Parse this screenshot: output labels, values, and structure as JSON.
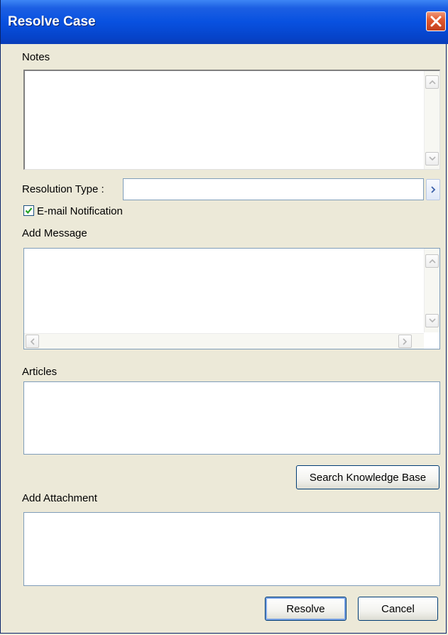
{
  "window": {
    "title": "Resolve Case"
  },
  "notes": {
    "label": "Notes",
    "value": ""
  },
  "resolution_type": {
    "label": "Resolution Type :",
    "value": ""
  },
  "email_notification": {
    "label": "E-mail Notification",
    "checked": true
  },
  "add_message": {
    "label": "Add Message",
    "value": ""
  },
  "articles": {
    "label": "Articles"
  },
  "search_kb": {
    "label": "Search Knowledge Base"
  },
  "add_attachment": {
    "label": "Add Attachment"
  },
  "footer": {
    "resolve_label": "Resolve",
    "cancel_label": "Cancel"
  },
  "icons": {
    "close": "close-icon",
    "scroll_up": "chevron-up-icon",
    "scroll_down": "chevron-down-icon",
    "scroll_left": "chevron-left-icon",
    "scroll_right": "chevron-right-icon",
    "browse": "chevron-right-icon",
    "check": "checkmark-icon"
  },
  "colors": {
    "titlebar": "#0851e0",
    "dialog_bg": "#ece9d8",
    "close": "#e2592f"
  }
}
